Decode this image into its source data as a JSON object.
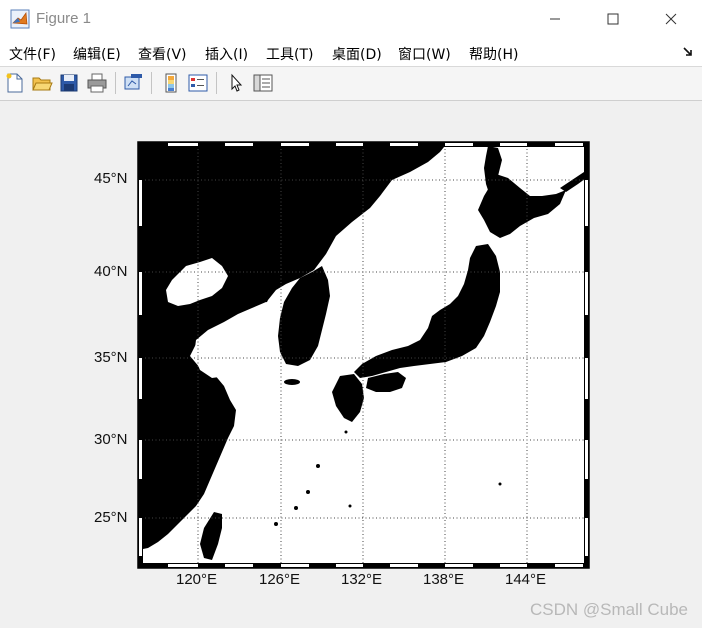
{
  "window": {
    "title": "Figure 1"
  },
  "menu": [
    {
      "label": "文件(F)"
    },
    {
      "label": "编辑(E)"
    },
    {
      "label": "查看(V)"
    },
    {
      "label": "插入(I)"
    },
    {
      "label": "工具(T)"
    },
    {
      "label": "桌面(D)"
    },
    {
      "label": "窗口(W)"
    },
    {
      "label": "帮助(H)"
    }
  ],
  "toolbar": [
    {
      "icon": "new-figure-icon"
    },
    {
      "icon": "open-file-icon"
    },
    {
      "icon": "save-icon"
    },
    {
      "icon": "print-icon"
    },
    {
      "icon": "link-plot-icon"
    },
    {
      "icon": "insert-colorbar-icon"
    },
    {
      "icon": "insert-legend-icon"
    },
    {
      "icon": "edit-plot-icon"
    },
    {
      "icon": "property-inspector-icon"
    }
  ],
  "map": {
    "lat_ticks": [
      "45°N",
      "40°N",
      "35°N",
      "30°N",
      "25°N"
    ],
    "lon_ticks": [
      "120°E",
      "126°E",
      "132°E",
      "138°E",
      "144°E"
    ],
    "lat_range": [
      22,
      47
    ],
    "lon_range": [
      116,
      149
    ],
    "land_color": "#000000",
    "sea_color": "#ffffff",
    "grid": "dotted"
  },
  "watermark": "CSDN @Small Cube"
}
